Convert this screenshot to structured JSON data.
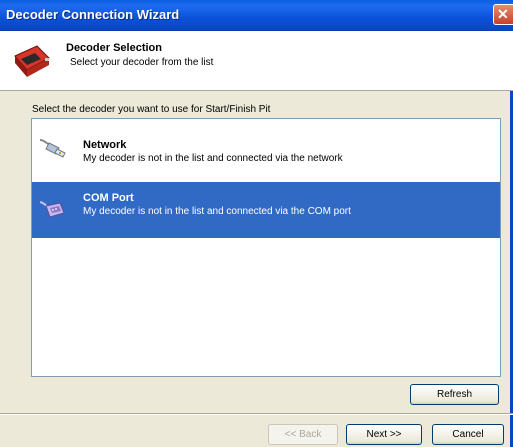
{
  "window": {
    "title": "Decoder Connection Wizard"
  },
  "header": {
    "title": "Decoder Selection",
    "subtitle": "Select your decoder from the list"
  },
  "prompt": "Select the decoder you want to use for Start/Finish Pit",
  "decoders": [
    {
      "name": "Network",
      "description": "My decoder is not in the list and connected via the network",
      "icon": "network-plug-icon",
      "selected": false
    },
    {
      "name": "COM Port",
      "description": "My decoder is not in the list and connected via the COM port",
      "icon": "com-port-icon",
      "selected": true
    }
  ],
  "buttons": {
    "refresh": "Refresh",
    "back": "<< Back",
    "next": "Next >>",
    "cancel": "Cancel"
  },
  "colors": {
    "selection": "#316ac5",
    "titlebar": "#0a5fe0"
  }
}
